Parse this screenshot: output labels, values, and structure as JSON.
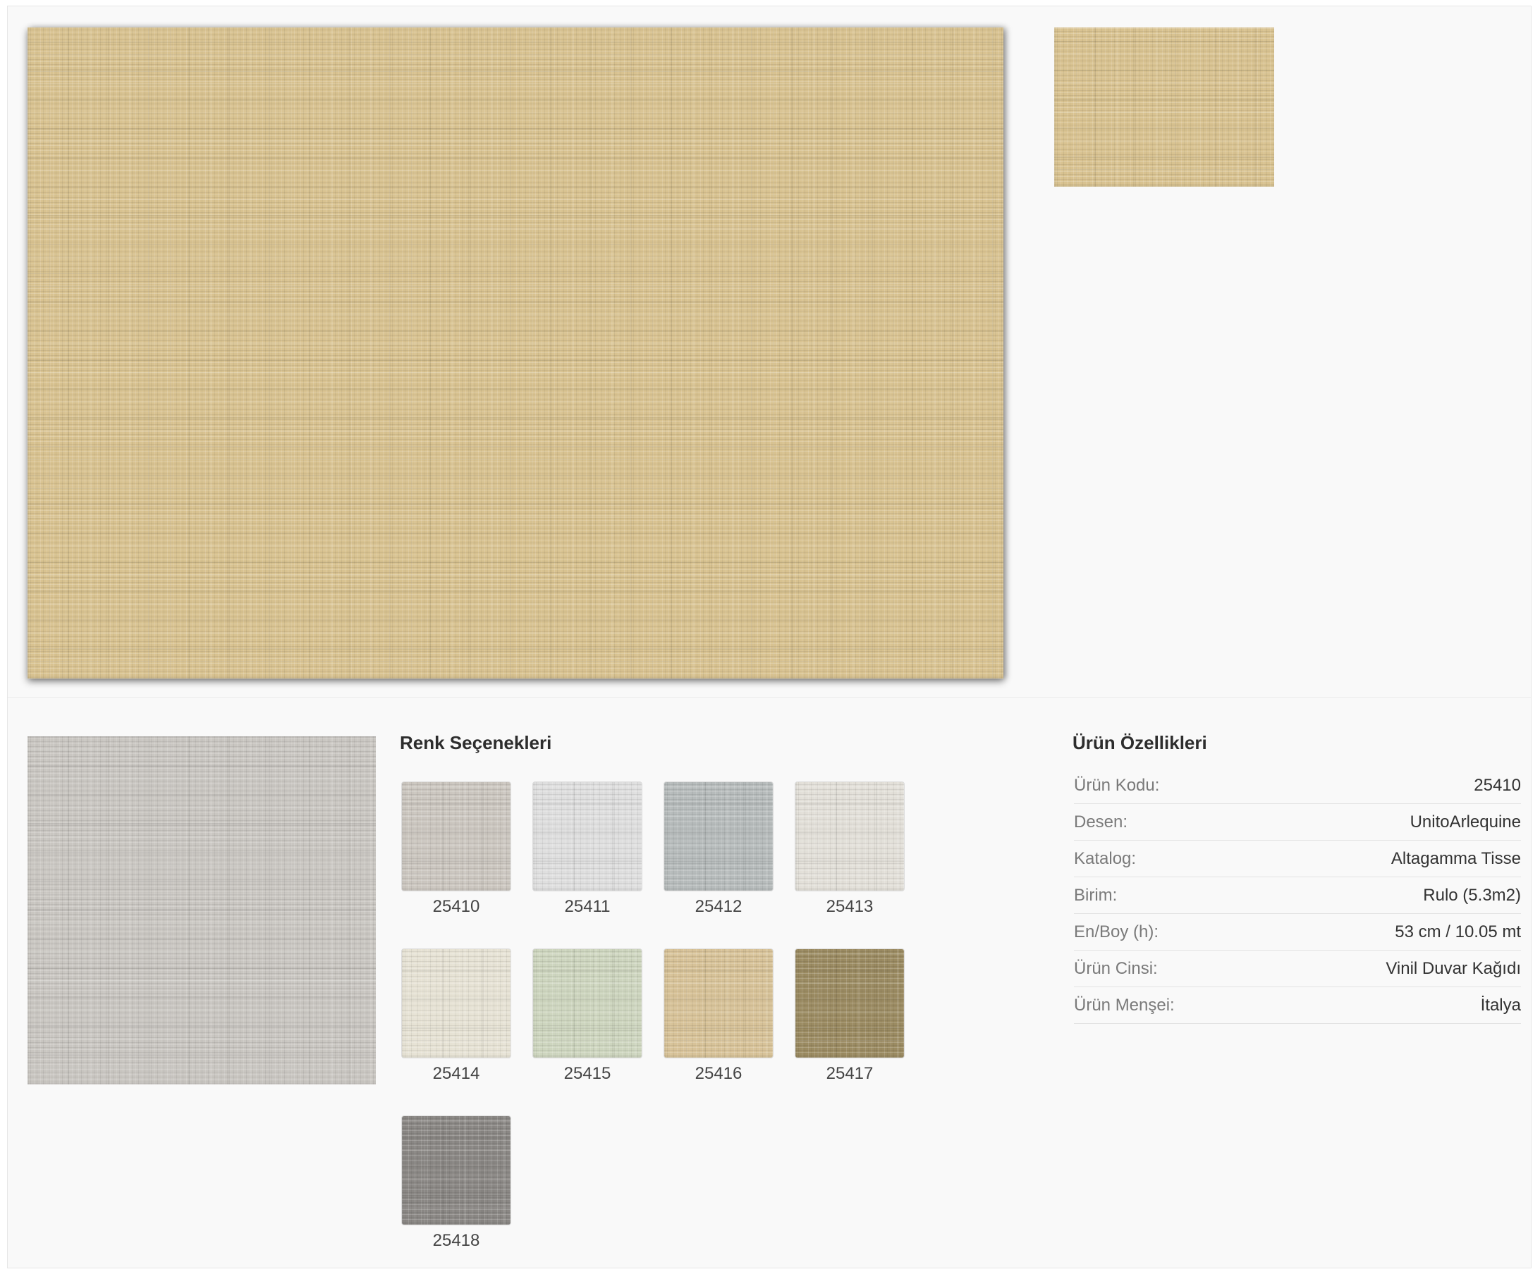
{
  "images": {
    "main": {
      "name": "main-product-image",
      "color": "#d8c290"
    },
    "thumbnail": {
      "name": "thumbnail-image",
      "color": "#d8c290"
    },
    "detail": {
      "name": "selected-swatch-image",
      "color": "#c9c6c1"
    }
  },
  "color_options": {
    "title": "Renk Seçenekleri",
    "swatches": [
      {
        "code": "25410",
        "color": "#cbc6bf"
      },
      {
        "code": "25411",
        "color": "#dedede"
      },
      {
        "code": "25412",
        "color": "#b6bbbb"
      },
      {
        "code": "25413",
        "color": "#e2dfd8"
      },
      {
        "code": "25414",
        "color": "#e6e2d4"
      },
      {
        "code": "25415",
        "color": "#cdd5be"
      },
      {
        "code": "25416",
        "color": "#d7c298"
      },
      {
        "code": "25417",
        "color": "#9b8b62"
      },
      {
        "code": "25418",
        "color": "#8a8784"
      }
    ]
  },
  "product_specs": {
    "title": "Ürün Özellikleri",
    "rows": [
      {
        "label": "Ürün Kodu:",
        "value": "25410"
      },
      {
        "label": "Desen:",
        "value": "UnitoArlequine"
      },
      {
        "label": "Katalog:",
        "value": "Altagamma Tisse"
      },
      {
        "label": "Birim:",
        "value": "Rulo (5.3m2)"
      },
      {
        "label": "En/Boy (h):",
        "value": "53 cm / 10.05 mt"
      },
      {
        "label": "Ürün Cinsi:",
        "value": "Vinil Duvar Kağıdı"
      },
      {
        "label": "Ürün Menşei:",
        "value": "İtalya"
      }
    ]
  }
}
